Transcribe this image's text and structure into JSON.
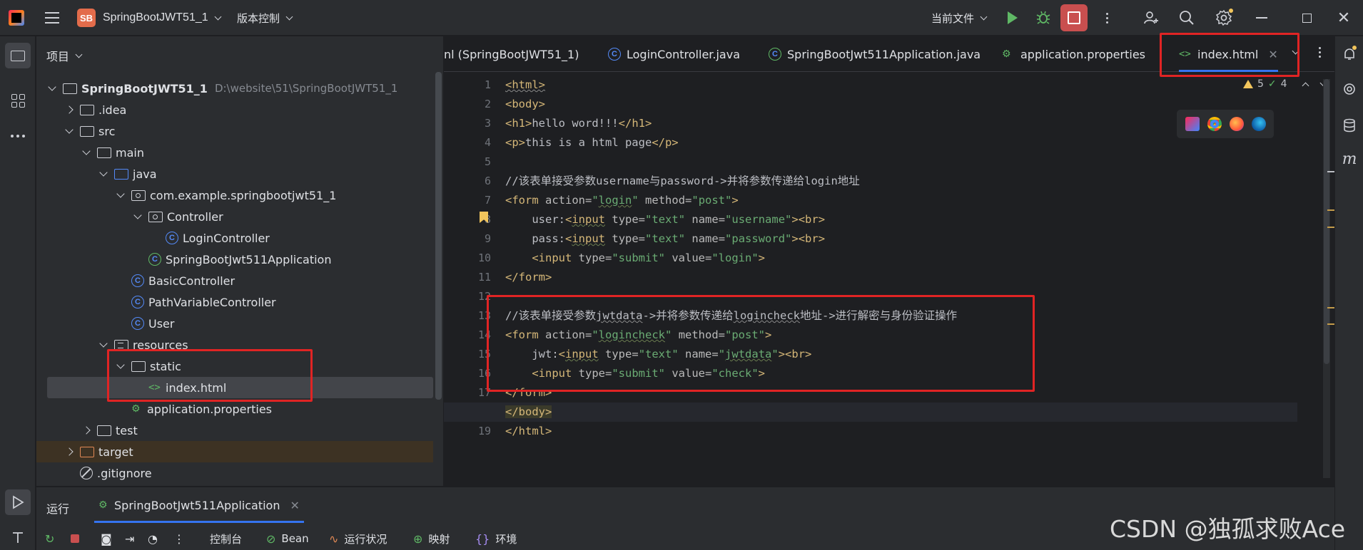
{
  "titlebar": {
    "project_badge": "SB",
    "project_name": "SpringBootJWT51_1",
    "vcs_label": "版本控制",
    "run_config": "当前文件"
  },
  "project_panel": {
    "header": "项目",
    "tree": [
      {
        "label": "SpringBootJWT51_1",
        "hint": "D:\\website\\51\\SpringBootJWT51_1"
      },
      {
        "label": ".idea"
      },
      {
        "label": "src"
      },
      {
        "label": "main"
      },
      {
        "label": "java"
      },
      {
        "label": "com.example.springbootjwt51_1"
      },
      {
        "label": "Controller"
      },
      {
        "label": "LoginController"
      },
      {
        "label": "SpringBootJwt511Application"
      },
      {
        "label": "BasicController"
      },
      {
        "label": "PathVariableController"
      },
      {
        "label": "User"
      },
      {
        "label": "resources"
      },
      {
        "label": "static"
      },
      {
        "label": "index.html"
      },
      {
        "label": "application.properties"
      },
      {
        "label": "test"
      },
      {
        "label": "target"
      },
      {
        "label": ".gitignore"
      }
    ]
  },
  "editor": {
    "tabs": [
      {
        "label": "nl (SpringBootJWT51_1)"
      },
      {
        "label": "LoginController.java"
      },
      {
        "label": "SpringBootJwt511Application.java"
      },
      {
        "label": "application.properties"
      },
      {
        "label": "index.html"
      }
    ],
    "inspections": {
      "warnings": "5",
      "ok": "4"
    },
    "line_numbers": [
      "1",
      "2",
      "3",
      "4",
      "5",
      "6",
      "7",
      "8",
      "9",
      "10",
      "11",
      "12",
      "13",
      "14",
      "15",
      "16",
      "17",
      "18",
      "19"
    ],
    "current_line": "18"
  },
  "run_panel": {
    "title": "运行",
    "tab": "SpringBootJwt511Application",
    "tools": {
      "console": "控制台",
      "bean": "Bean",
      "health": "运行状况",
      "mapping": "映射",
      "env": "环境"
    }
  },
  "watermark": "CSDN @独孤求败Ace",
  "colors": {
    "accent": "#3574f0",
    "annotation_red": "#e02424",
    "run_green": "#5fb865",
    "stop_red": "#c94f4f"
  }
}
